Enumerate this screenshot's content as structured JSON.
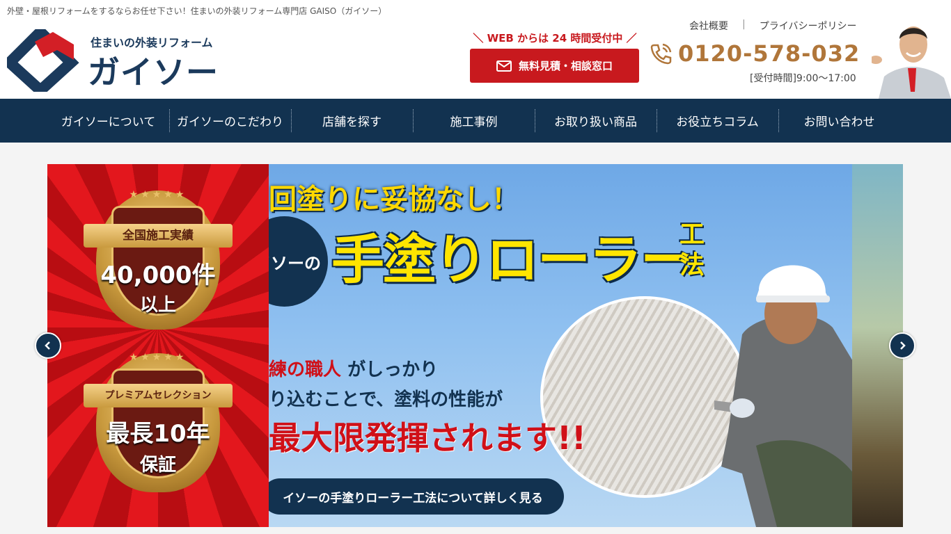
{
  "header": {
    "tagline": "外壁・屋根リフォームをするならお任せ下さい！住まいの外装リフォーム専門店 GAISO（ガイソー）",
    "logo_sub": "住まいの外装リフォーム",
    "logo_main": "ガイソー",
    "web_label": "WEB からは 24 時間受付中",
    "cta_label": "無料見積・相談窓口",
    "link_company": "会社概要",
    "link_privacy": "プライバシーポリシー",
    "phone": "0120-578-032",
    "hours": "[受付時間]9:00〜17:00"
  },
  "nav": {
    "items": [
      {
        "label": "ガイソーについて"
      },
      {
        "label": "ガイソーのこだわり"
      },
      {
        "label": "店舗を探す"
      },
      {
        "label": "施工事例"
      },
      {
        "label": "お取り扱い商品"
      },
      {
        "label": "お役立ちコラム"
      },
      {
        "label": "お問い合わせ"
      }
    ]
  },
  "hero": {
    "badge1": {
      "ribbon": "全国施工実績",
      "big": "40,000件",
      "small": "以上"
    },
    "badge2": {
      "ribbon": "プレミアムセレクション",
      "big": "最長10年",
      "small": "保証"
    },
    "headline": "回塗りに妥協なし！",
    "circle_label": "イソーの",
    "big_title": "手塗りローラー",
    "big_title_side": "工法",
    "line1_red": "練の職人",
    "line1_rest": "がしっかり",
    "line2": "り込むことで、塗料の性能が",
    "line3": "最大限発揮されます!!",
    "detail_button": "イソーの手塗りローラー工法について詳しく見る"
  },
  "colors": {
    "navy": "#123250",
    "red": "#c8191e",
    "gold": "#b0763a"
  },
  "icons": [
    "mail-icon",
    "phone-icon",
    "chevron-left-icon",
    "chevron-right-icon"
  ]
}
